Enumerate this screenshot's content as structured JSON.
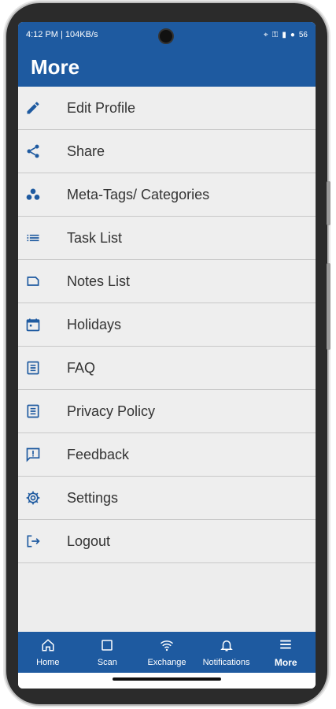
{
  "status_bar": {
    "left_text": "4:12 PM | 104KB/s",
    "battery": "56"
  },
  "header": {
    "title": "More"
  },
  "menu": [
    {
      "label": "Edit Profile",
      "icon": "pencil-icon"
    },
    {
      "label": "Share",
      "icon": "share-icon"
    },
    {
      "label": "Meta-Tags/ Categories",
      "icon": "category-icon"
    },
    {
      "label": "Task List",
      "icon": "list-icon"
    },
    {
      "label": "Notes List",
      "icon": "note-icon"
    },
    {
      "label": "Holidays",
      "icon": "calendar-icon"
    },
    {
      "label": "FAQ",
      "icon": "document-icon"
    },
    {
      "label": "Privacy Policy",
      "icon": "document-icon"
    },
    {
      "label": "Feedback",
      "icon": "feedback-icon"
    },
    {
      "label": "Settings",
      "icon": "gear-icon"
    },
    {
      "label": "Logout",
      "icon": "logout-icon"
    }
  ],
  "bottom_nav": [
    {
      "label": "Home",
      "icon": "home-icon"
    },
    {
      "label": "Scan",
      "icon": "scan-icon"
    },
    {
      "label": "Exchange",
      "icon": "wifi-icon"
    },
    {
      "label": "Notifications",
      "icon": "bell-icon"
    },
    {
      "label": "More",
      "icon": "menu-icon",
      "active": true
    }
  ],
  "colors": {
    "primary": "#1e5aa0",
    "list_bg": "#eeeeee",
    "divider": "#c8c8c8",
    "text": "#333333"
  }
}
